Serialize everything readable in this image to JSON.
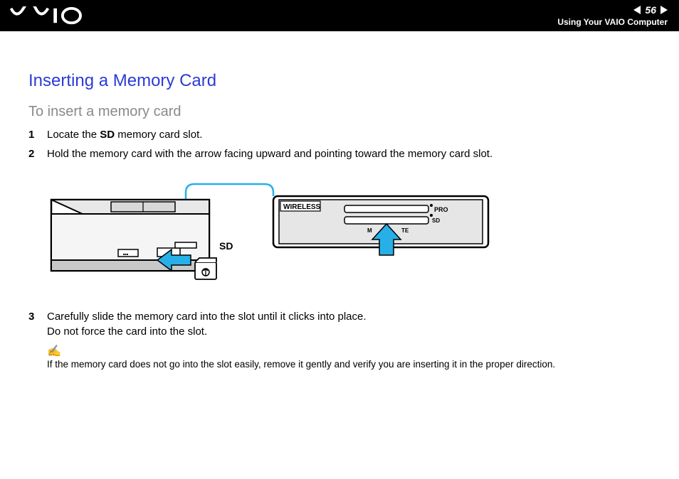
{
  "header": {
    "page_number": "56",
    "breadcrumb": "Using Your VAIO Computer"
  },
  "content": {
    "title": "Inserting a Memory Card",
    "subtitle": "To insert a memory card",
    "steps": [
      {
        "num": "1",
        "prefix": "Locate the ",
        "bold": "SD",
        "suffix": " memory card slot."
      },
      {
        "num": "2",
        "prefix": "Hold the memory card with the arrow facing upward and pointing toward the memory card slot.",
        "bold": "",
        "suffix": ""
      },
      {
        "num": "3",
        "prefix": "Carefully slide the memory card into the slot until it clicks into place.",
        "bold": "",
        "suffix": "",
        "line2": "Do not force the card into the slot."
      }
    ],
    "note": "If the memory card does not go into the slot easily, remove it gently and verify you are inserting it in the proper direction.",
    "figure_labels": {
      "sd_side": "SD",
      "wireless": "WIRELESS",
      "pro": "PRO",
      "sd_front": "SD",
      "m_te": "M          TE"
    }
  }
}
